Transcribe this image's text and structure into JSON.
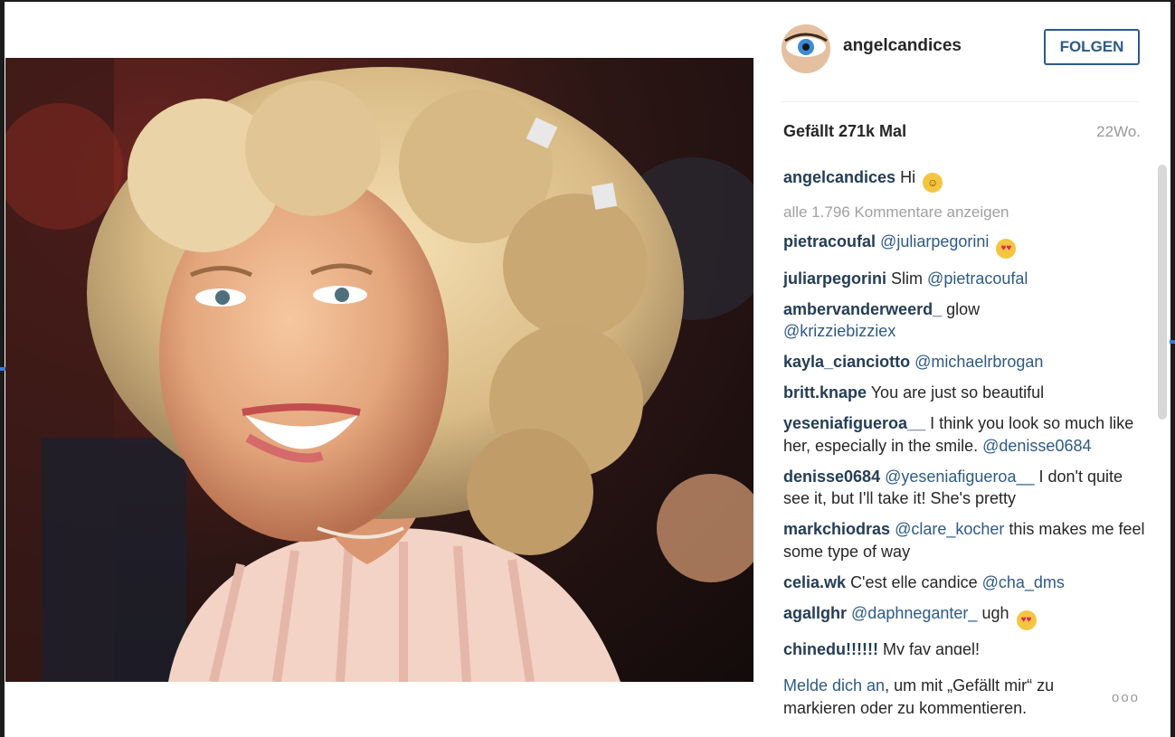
{
  "post": {
    "username": "angelcandices",
    "follow_label": "FOLGEN",
    "likes": "Gefällt 271k Mal",
    "age": "22Wo.",
    "more_label": "ooo"
  },
  "caption": {
    "user": "angelcandices",
    "text": "Hi",
    "emoji": "tongue-face-emoji"
  },
  "view_all_comments": "alle 1.796 Kommentare anzeigen",
  "comments": [
    {
      "user": "pietracoufal",
      "mention": "@juliarpegorini",
      "text": "",
      "emoji": "heart-eyes-emoji"
    },
    {
      "user": "juliarpegorini",
      "text": "Slim",
      "mention": "@pietracoufal"
    },
    {
      "user": "ambervanderweerd_",
      "text": "glow",
      "mention": "@krizziebizziex"
    },
    {
      "user": "kayla_cianciotto",
      "mention": "@michaelrbrogan"
    },
    {
      "user": "britt.knape",
      "text": "You are just so beautiful"
    },
    {
      "user": "yeseniafigueroa__",
      "text": "I think you look so much like her, especially in the smile.",
      "mention": "@denisse0684"
    },
    {
      "user": "denisse0684",
      "mention": "@yeseniafigueroa__",
      "text": "I don't quite see it, but I'll take it! She's pretty"
    },
    {
      "user": "markchiodras",
      "mention": "@clare_kocher",
      "text": "this makes me feel some type of way"
    },
    {
      "user": "celia.wk",
      "text": "C'est elle candice",
      "mention": "@cha_dms"
    },
    {
      "user": "agallghr",
      "mention": "@daphneganter_",
      "text": "ugh",
      "emoji": "heart-eyes-emoji"
    },
    {
      "user": "chinedu!!!!!!",
      "text": "My fav angel!"
    }
  ],
  "login": {
    "link": "Melde dich an",
    "text": ", um mit „Gefällt mir“ zu markieren oder zu kommentieren."
  },
  "colors": {
    "username": "#262626",
    "link_blue": "#2d5a86",
    "muted": "#9a9a9a"
  }
}
